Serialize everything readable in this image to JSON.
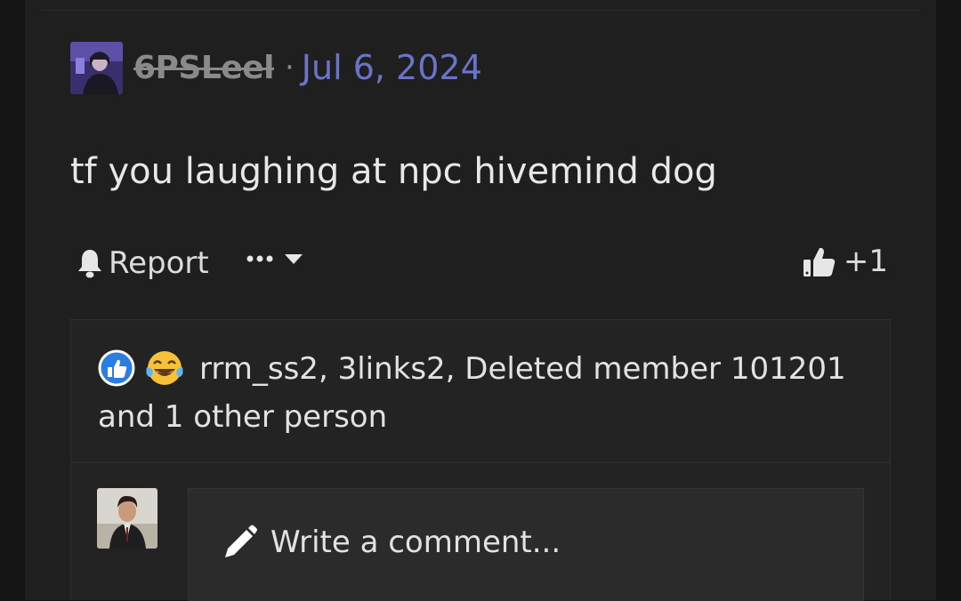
{
  "post": {
    "author": {
      "username": "6PSLeel",
      "avatar_icon": "user-avatar"
    },
    "separator": "·",
    "date": "Jul 6, 2024",
    "text": "tf you laughing at npc hivemind dog"
  },
  "actions": {
    "report_label": "Report",
    "report_icon": "bell-icon",
    "more_icon": "ellipsis-icon",
    "dropdown_icon": "caret-down-icon",
    "like_icon": "thumbs-up-icon",
    "like_count": "+1"
  },
  "reactions": {
    "icons": [
      "like-reaction-icon",
      "laugh-cry-reaction-icon"
    ],
    "summary": "rrm_ss2, 3links2, Deleted member 101201 and 1 other person"
  },
  "comment": {
    "placeholder": "Write a comment...",
    "placeholder_icon": "pencil-icon"
  },
  "colors": {
    "background": "#1f1f1f",
    "date_accent": "#6a74c8",
    "like_blue": "#2b7de1",
    "emoji_yellow": "#f7c23a"
  }
}
